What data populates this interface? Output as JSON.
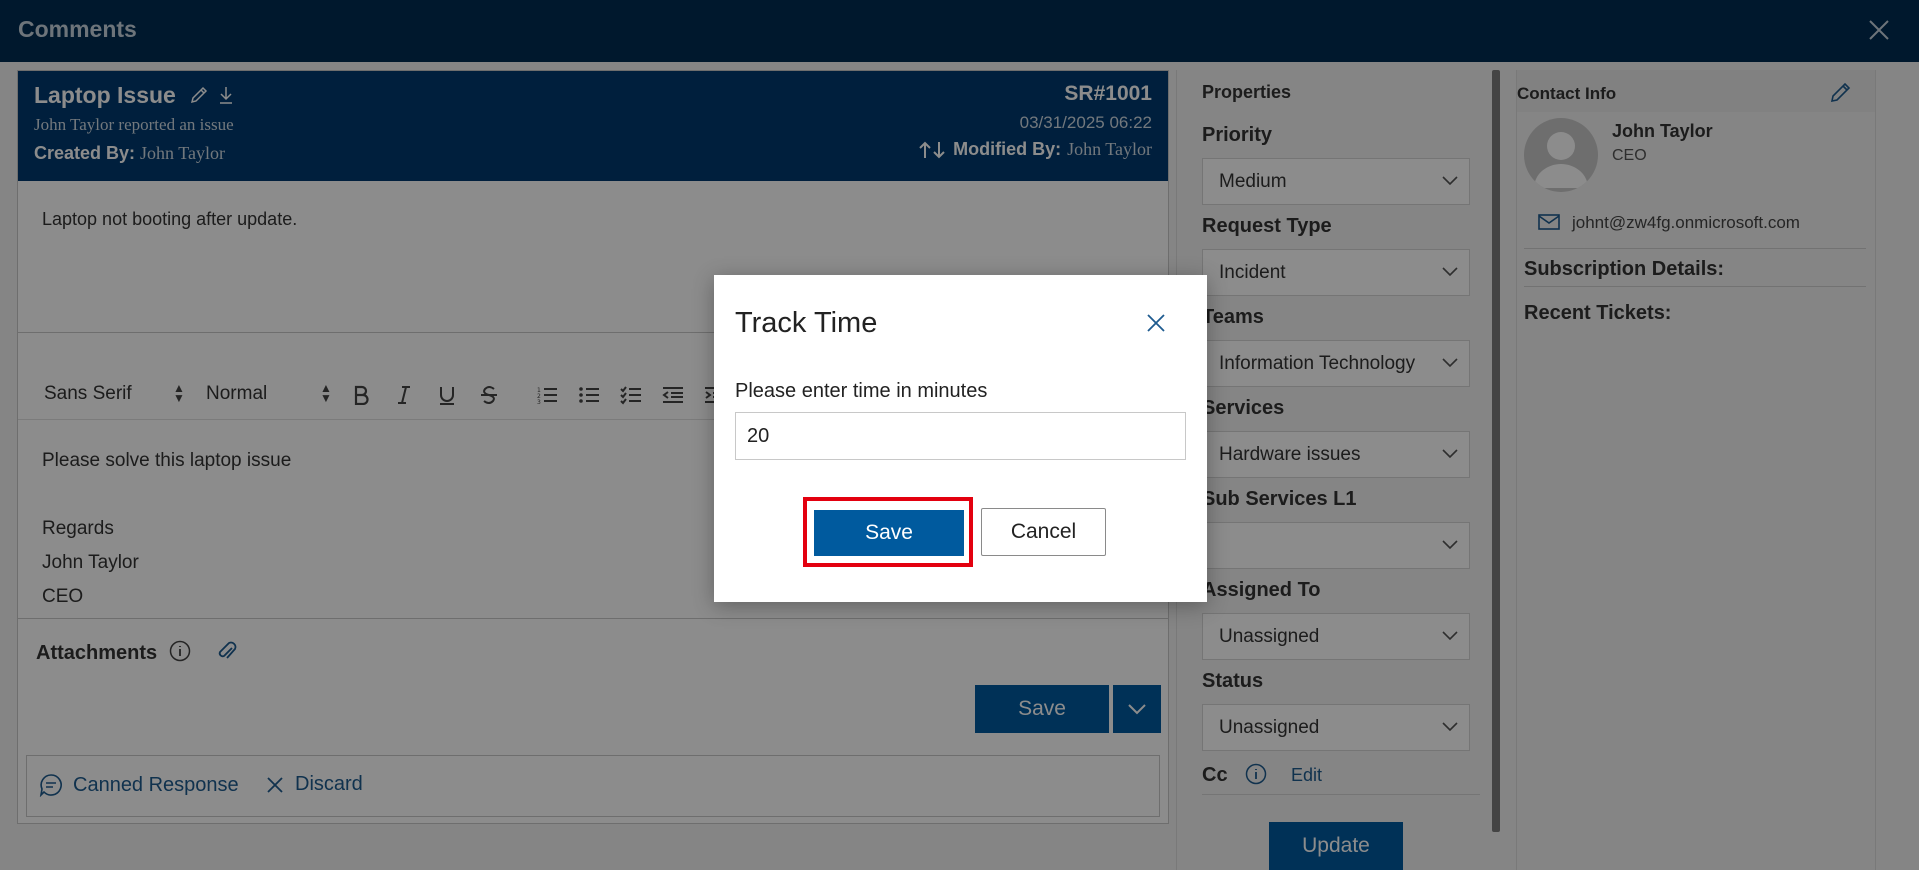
{
  "window": {
    "title": "Comments",
    "close_icon": "close-icon"
  },
  "ticket": {
    "title": "Laptop Issue",
    "reported": "John Taylor reported an issue",
    "created_label": "Created By:",
    "created_by": "John Taylor",
    "sr": "SR#1001",
    "date": "03/31/2025 06:22",
    "modified_label": "Modified By:",
    "modified_by": "John Taylor",
    "description": "Laptop not booting after update."
  },
  "toolbar": {
    "font": "Sans Serif",
    "size": "Normal"
  },
  "editor": {
    "lines": [
      "Please solve this laptop issue",
      "",
      "Regards",
      "John Taylor",
      "CEO"
    ]
  },
  "attachments": {
    "label": "Attachments"
  },
  "actions": {
    "save": "Save",
    "canned": "Canned Response",
    "discard": "Discard"
  },
  "properties": {
    "title": "Properties",
    "fields": [
      {
        "label": "Priority",
        "value": "Medium"
      },
      {
        "label": "Request Type",
        "value": "Incident"
      },
      {
        "label": "Teams",
        "value": "Information Technology"
      },
      {
        "label": "Services",
        "value": "Hardware issues"
      },
      {
        "label": "Sub Services L1",
        "value": ""
      },
      {
        "label": "Assigned To",
        "value": "Unassigned"
      },
      {
        "label": "Status",
        "value": "Unassigned"
      }
    ],
    "cc_label": "Cc",
    "cc_edit": "Edit",
    "update": "Update"
  },
  "contact": {
    "title": "Contact Info",
    "name": "John Taylor",
    "role": "CEO",
    "email": "johnt@zw4fg.onmicrosoft.com",
    "subscription": "Subscription Details:",
    "recent": "Recent Tickets:"
  },
  "modal": {
    "title": "Track Time",
    "label": "Please enter time in minutes",
    "value": "20",
    "save": "Save",
    "cancel": "Cancel"
  },
  "colors": {
    "header": "#002c52",
    "ticket_header": "#003a6f",
    "primary": "#005a9e",
    "link": "#1e5b8f",
    "highlight": "#e3000f"
  }
}
